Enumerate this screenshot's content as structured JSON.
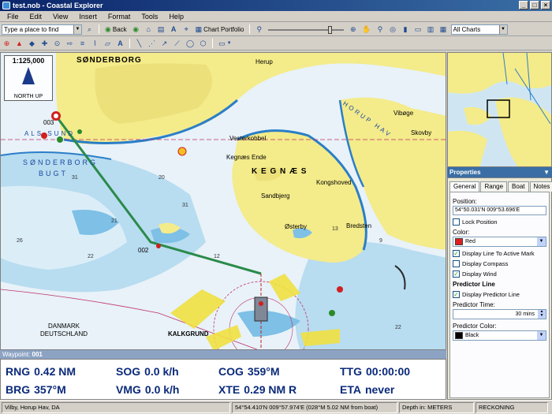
{
  "window": {
    "title": "test.nob - Coastal Explorer"
  },
  "menu": [
    "File",
    "Edit",
    "View",
    "Insert",
    "Format",
    "Tools",
    "Help"
  ],
  "toolbar": {
    "place_search_placeholder": "Type a place to find",
    "back_label": "Back",
    "chart_portfolio_label": "Chart Portfolio",
    "charts_filter_value": "All Charts"
  },
  "chart": {
    "scale": "1:125,000",
    "orientation": "NORTH UP",
    "labels": {
      "sonderborg": "SØNDERBORG",
      "sonderborg_bugt_1": "SØNDERBORG",
      "sonderborg_bugt_2": "BUGT",
      "kegnaes": "K E G N Æ S",
      "horup_hav": "HORUP HAV",
      "als_sund": "ALS SUND",
      "denmark": "DANMARK",
      "deutschland": "DEUTSCHLAND",
      "kalkgrund": "KALKGRUND",
      "kegnaes_ende": "Kegnæs Ende",
      "sandbjerg": "Sandbjerg",
      "osterby": "Østerby",
      "bredsten": "Bredsten",
      "kongshoved": "Kongshoved",
      "vesterkobbel": "Vesterkobbel",
      "herup": "Herup",
      "vibøge": "Vibøge",
      "skovby": "Skovby",
      "waypoint_002": "002",
      "waypoint_003": "003"
    }
  },
  "waypoint": {
    "label": "Waypoint:",
    "id": "001"
  },
  "nav": {
    "rng": {
      "label": "RNG",
      "value": "0.42 NM"
    },
    "brg": {
      "label": "BRG",
      "value": "357°M"
    },
    "sog": {
      "label": "SOG",
      "value": "0.0 k/h"
    },
    "vmg": {
      "label": "VMG",
      "value": "0.0 k/h"
    },
    "cog": {
      "label": "COG",
      "value": "359°M"
    },
    "xte": {
      "label": "XTE",
      "value": "0.29 NM R"
    },
    "ttg": {
      "label": "TTG",
      "value": "00:00:00"
    },
    "eta": {
      "label": "ETA",
      "value": "never"
    }
  },
  "properties": {
    "header": "Properties",
    "tabs": [
      "General",
      "Range",
      "Boat",
      "Notes"
    ],
    "position_label": "Position:",
    "position_value": "54°50.031'N 009°53.696'E",
    "lock_position": "Lock Position",
    "color_label": "Color:",
    "color_value": "Red",
    "color_hex": "#e02020",
    "display_line": "Display Line To Active Mark",
    "display_compass": "Display Compass",
    "display_wind": "Display Wind",
    "predictor_header": "Predictor Line",
    "display_predictor": "Display Predictor Line",
    "predictor_time_label": "Predictor Time:",
    "predictor_time_value": "30 mins",
    "predictor_color_label": "Predictor Color:",
    "predictor_color_value": "Black",
    "predictor_color_hex": "#000000"
  },
  "status": {
    "location": "Vilby, Horup Hav, DA",
    "cursor": "54°54.410'N 009°57.974'E (028°M 5.02 NM from boat)",
    "depth": "Depth in: METERS",
    "mode": "RECKONING"
  }
}
